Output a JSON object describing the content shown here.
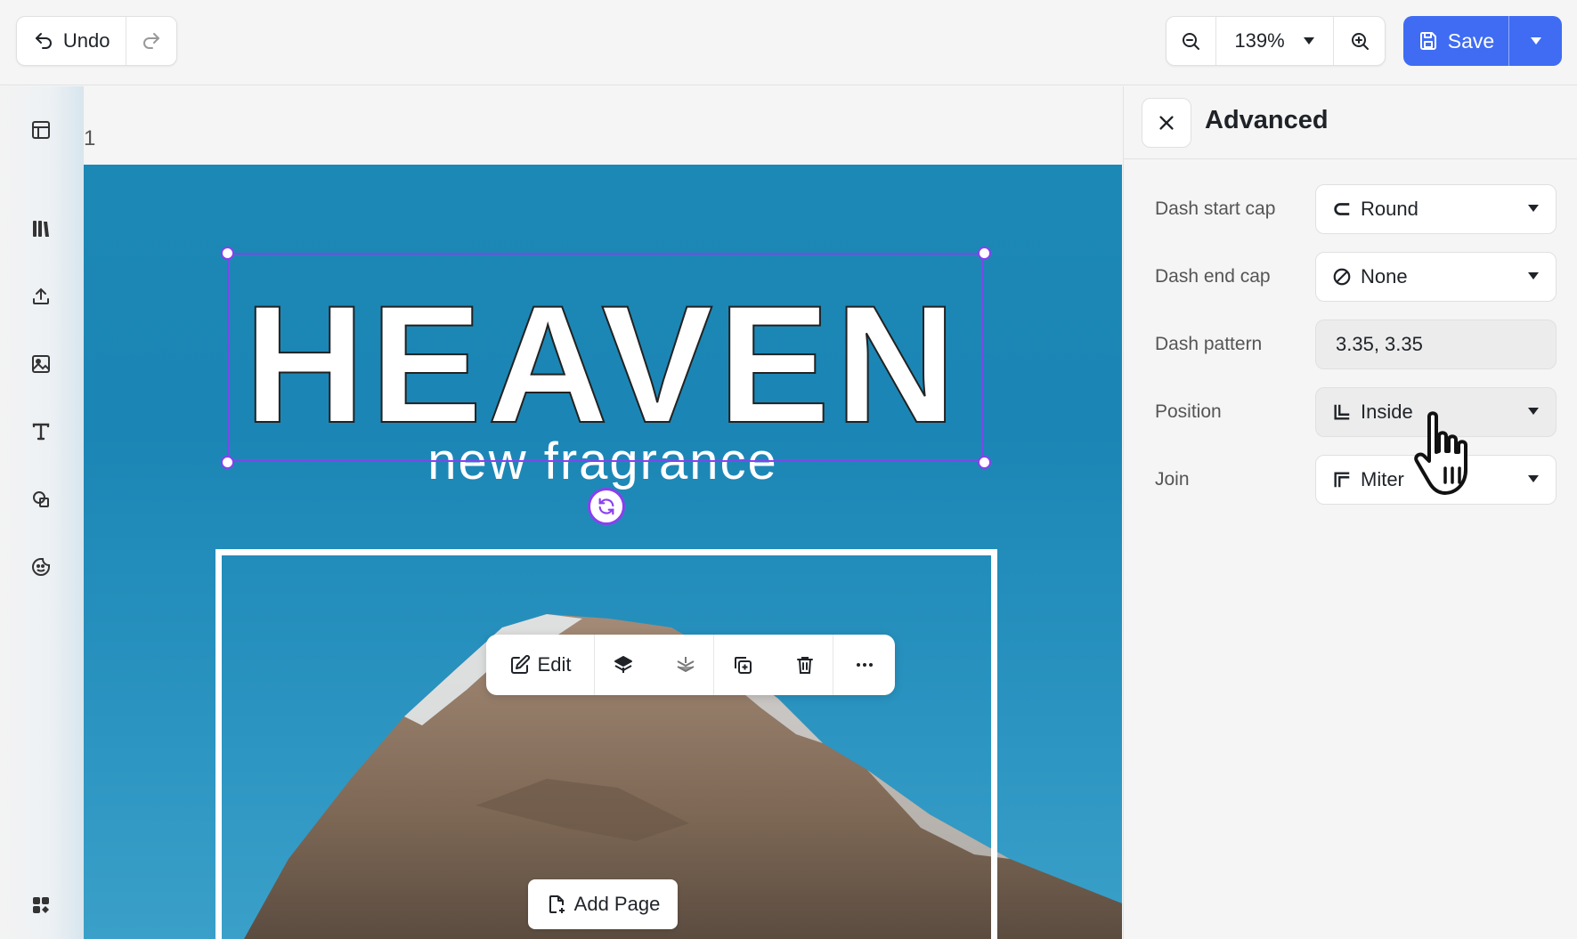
{
  "toolbar": {
    "undo_label": "Undo",
    "zoom_value": "139%",
    "save_label": "Save"
  },
  "canvas": {
    "page_number": "1",
    "headline": "HEAVEN",
    "tagline": "new fragrance",
    "background_color": "#1b86b5",
    "selection_color": "#8a3ff0"
  },
  "floating_toolbar": {
    "edit_label": "Edit"
  },
  "add_page_label": "Add Page",
  "panel": {
    "title": "Advanced",
    "rows": [
      {
        "label": "Dash start cap",
        "value": "Round",
        "icon": "round-cap-icon"
      },
      {
        "label": "Dash end cap",
        "value": "None",
        "icon": "none-icon"
      },
      {
        "label": "Dash pattern",
        "value": "3.35, 3.35"
      },
      {
        "label": "Position",
        "value": "Inside",
        "icon": "inside-position-icon"
      },
      {
        "label": "Join",
        "value": "Miter",
        "icon": "miter-join-icon"
      }
    ]
  },
  "colors": {
    "accent": "#3f6cf3",
    "selection": "#8a3ff0"
  }
}
